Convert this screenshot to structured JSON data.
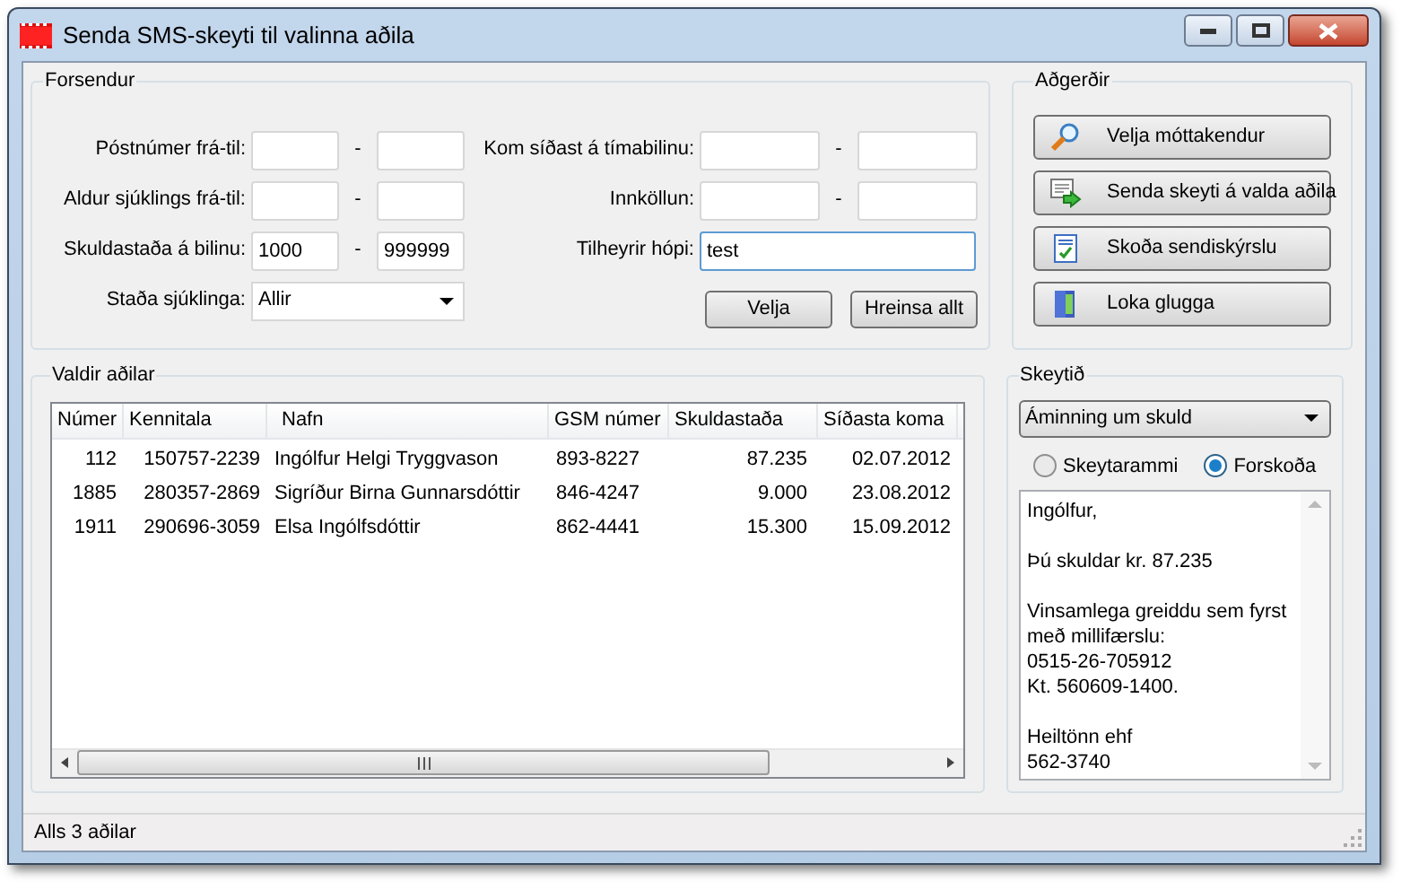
{
  "window": {
    "title": "Senda SMS-skeyti til valinna aðila"
  },
  "criteria": {
    "title": "Forsendur",
    "left": [
      {
        "label": "Póstnúmer frá-til:",
        "kind": "range",
        "separator": "-"
      },
      {
        "label": "Aldur sjúklings frá-til:",
        "kind": "range",
        "separator": "-"
      },
      {
        "label": "Skuldastaða á bilinu:",
        "kind": "range",
        "from": "1000",
        "to": "999999",
        "separator": "-"
      },
      {
        "label": "Staða sjúklinga:",
        "kind": "dropdown",
        "value": "Allir"
      }
    ],
    "right": [
      {
        "label": "Kom síðast á tímabilinu:",
        "kind": "range",
        "separator": "-"
      },
      {
        "label": "Innköllun:",
        "kind": "range",
        "separator": "-"
      },
      {
        "label": "Tilheyrir hópi:",
        "kind": "text",
        "value": "test",
        "focused": true
      }
    ],
    "buttons": [
      "Velja",
      "Hreinsa allt"
    ]
  },
  "actions": {
    "title": "Aðgerðir",
    "buttons": [
      {
        "label": "Velja móttakendur"
      },
      {
        "label": "Senda skeyti á valda aðila"
      },
      {
        "label": "Skoða sendiskýrslu"
      },
      {
        "label": "Loka glugga"
      }
    ]
  },
  "table": {
    "title": "Valdir aðilar",
    "columns": [
      "Númer",
      "Kennitala",
      "Nafn",
      "GSM númer",
      "Skuldastaða",
      "Síðasta koma"
    ],
    "rows": [
      [
        "112",
        "150757-2239",
        "Ingólfur Helgi Tryggvason",
        "893-8227",
        "87.235",
        "02.07.2012"
      ],
      [
        "1885",
        "280357-2869",
        "Sigríður Birna Gunnarsdóttir",
        "846-4247",
        "9.000",
        "23.08.2012"
      ],
      [
        "1911",
        "290696-3059",
        "Elsa Ingólfsdóttir",
        "862-4441",
        "15.300",
        "15.09.2012"
      ]
    ]
  },
  "message": {
    "title": "Skeytið",
    "template": "Áminning um skuld",
    "modes": [
      {
        "label": "Skeytarammi",
        "selected": false
      },
      {
        "label": "Forskoða",
        "selected": true
      }
    ],
    "paragraphs": [
      [
        "Ingólfur,"
      ],
      [
        "Þú skuldar kr. 87.235"
      ],
      [
        "Vinsamlega greiddu sem fyrst",
        "með millifærslu:",
        "0515-26-705912",
        "Kt. 560609-1400."
      ],
      [
        "Heiltönn ehf",
        "562-3740"
      ]
    ]
  },
  "status_bar": {
    "text": "Alls 3 aðilar"
  }
}
